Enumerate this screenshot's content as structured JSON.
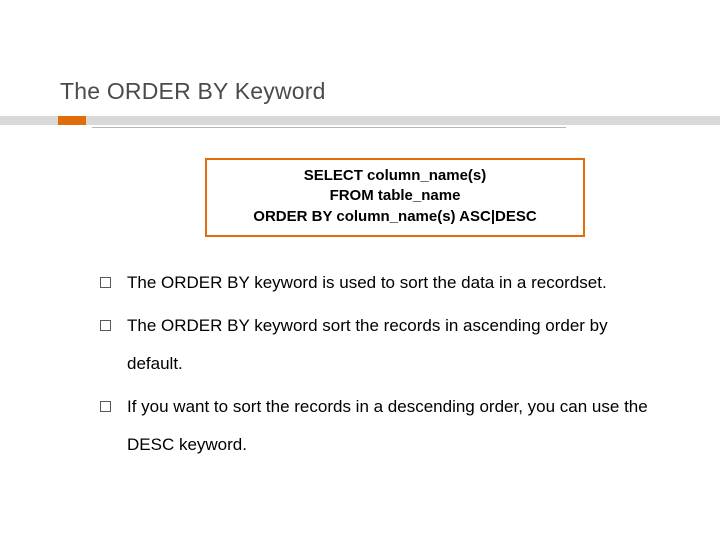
{
  "title": "The ORDER BY Keyword",
  "code": {
    "line1": "SELECT column_name(s)",
    "line2": "FROM table_name",
    "line3": "ORDER BY column_name(s) ASC|DESC"
  },
  "bullets": [
    "The ORDER BY keyword is used to sort the data in a recordset.",
    "The ORDER BY keyword sort the records in ascending order by default.",
    "If you want to sort the records in a descending order, you can use the DESC keyword."
  ]
}
